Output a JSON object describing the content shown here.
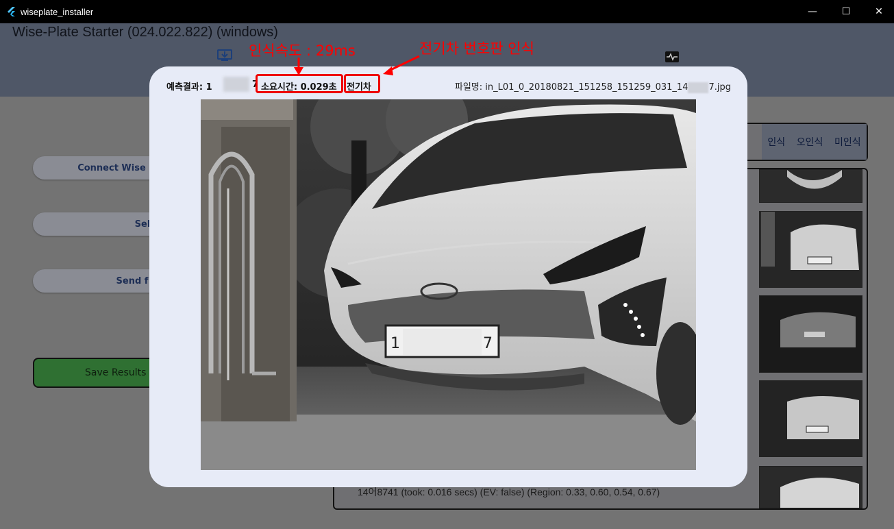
{
  "window": {
    "title": "wiseplate_installer",
    "minimize": "—",
    "maximize": "☐",
    "close": "✕"
  },
  "app": {
    "title": "Wise-Plate Starter (024.022.822) (windows)"
  },
  "sidebar": {
    "connect": "Connect Wise",
    "select": "Sel",
    "send": "Send f",
    "save": "Save Results"
  },
  "tabs": [
    "인식",
    "오인식",
    "미인식"
  ],
  "results": {
    "line": "14어8741 (took: 0.016 secs) (EV: false) (Region: 0.33, 0.60, 0.54, 0.67)"
  },
  "dialog": {
    "prediction_label": "예측결과: 1",
    "prediction_tail": "7",
    "time_label": "소요시간: 0.029초",
    "ev_label": "전기차",
    "file_label": "파일명: in_L01_0_20180821_151258_151259_031_14",
    "file_tail": "7.jpg"
  },
  "annotations": {
    "speed": "인식속도 : 29ms",
    "ev_plate": "전기차 번호판 인식"
  },
  "photo": {
    "plate_prefix": "1",
    "plate_suffix": "7"
  },
  "colors": {
    "annotation": "#ff0000",
    "dialog_bg": "#e7ebf7",
    "save_button": "#2f7032"
  }
}
